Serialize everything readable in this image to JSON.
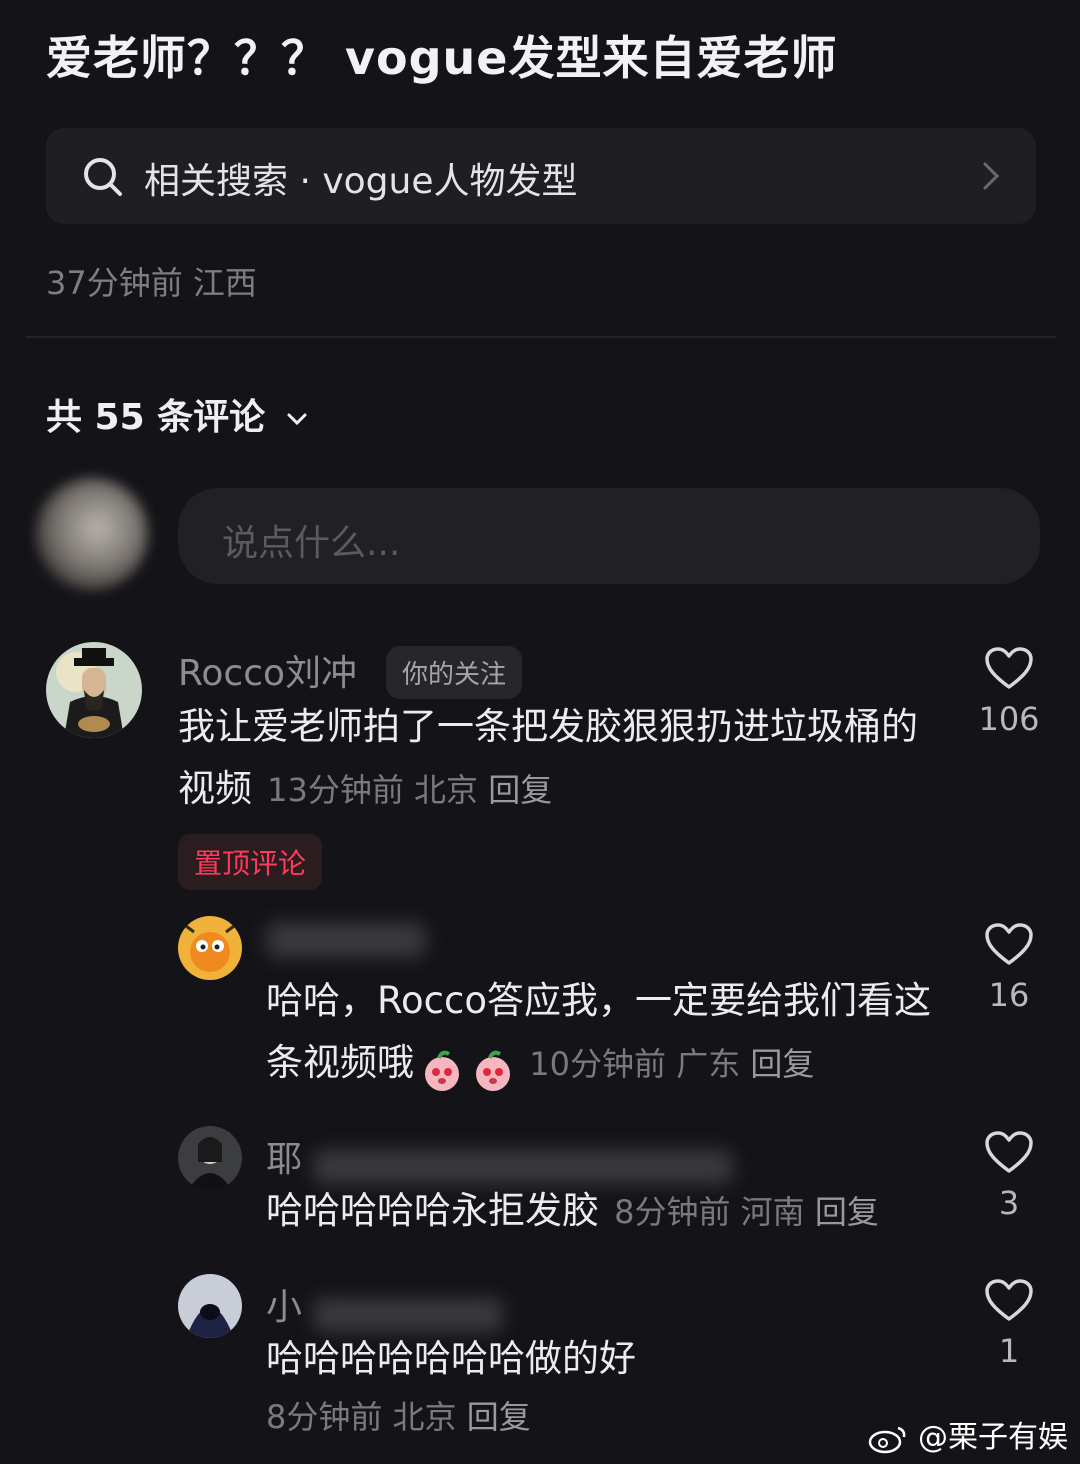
{
  "post": {
    "title": "爱老师？？？ vogue发型来自爱老师",
    "meta": "37分钟前 江西"
  },
  "related_search": {
    "text": "相关搜索 · vogue人物发型"
  },
  "comments_header": {
    "count_label": "共 55 条评论"
  },
  "comment_input": {
    "placeholder": "说点什么..."
  },
  "comments": [
    {
      "user": "Rocco刘冲",
      "tag": "你的关注",
      "text": "我让爱老师拍了一条把发胶狠狠扔进垃圾桶的视频",
      "time": "13分钟前",
      "location": "北京",
      "reply": "回复",
      "likes": "106",
      "pinned_label": "置顶评论"
    }
  ],
  "replies": [
    {
      "user": "",
      "text": "哈哈，Rocco答应我，一定要给我们看这条视频哦",
      "emoji": "peach-emoji",
      "time": "10分钟前",
      "location": "广东",
      "reply": "回复",
      "likes": "16"
    },
    {
      "user": "耶",
      "text": "哈哈哈哈哈永拒发胶",
      "time": "8分钟前",
      "location": "河南",
      "reply": "回复",
      "likes": "3"
    },
    {
      "user": "小",
      "text": "哈哈哈哈哈哈哈做的好",
      "time": "8分钟前",
      "location": "北京",
      "reply": "回复",
      "likes": "1"
    }
  ],
  "watermark": {
    "text": "@栗子有娱"
  },
  "colors": {
    "background": "#141317",
    "pinned_red": "#ff3a5a"
  }
}
